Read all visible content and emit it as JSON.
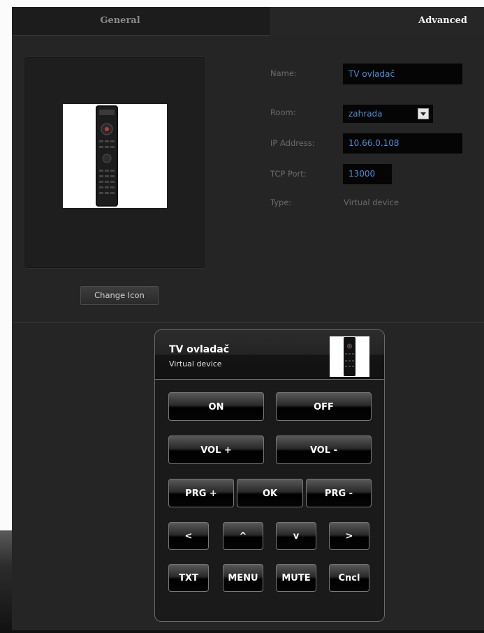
{
  "tabs": {
    "general": "General",
    "advanced": "Advanced"
  },
  "icon_panel": {
    "change_icon_label": "Change Icon"
  },
  "form": {
    "name_label": "Name:",
    "name_value": "TV ovladač",
    "room_label": "Room:",
    "room_value": "zahrada",
    "ip_label": "IP Address:",
    "ip_value": "10.66.0.108",
    "port_label": "TCP Port:",
    "port_value": "13000",
    "type_label": "Type:",
    "type_value": "Virtual device"
  },
  "remote": {
    "title": "TV ovladač",
    "subtitle": "Virtual device",
    "buttons": {
      "on": "ON",
      "off": "OFF",
      "vol_up": "VOL +",
      "vol_down": "VOL -",
      "prg_up": "PRG +",
      "ok": "OK",
      "prg_down": "PRG -",
      "left": "<",
      "up": "^",
      "down": "v",
      "right": ">",
      "txt": "TXT",
      "menu": "MENU",
      "mute": "MUTE",
      "cncl": "Cncl"
    }
  },
  "colors": {
    "panel_bg": "#252525",
    "field_text": "#4a8fd9",
    "label_text": "#6b6b6b"
  },
  "icons": [
    "remote-control-image",
    "chevron-down-icon"
  ]
}
